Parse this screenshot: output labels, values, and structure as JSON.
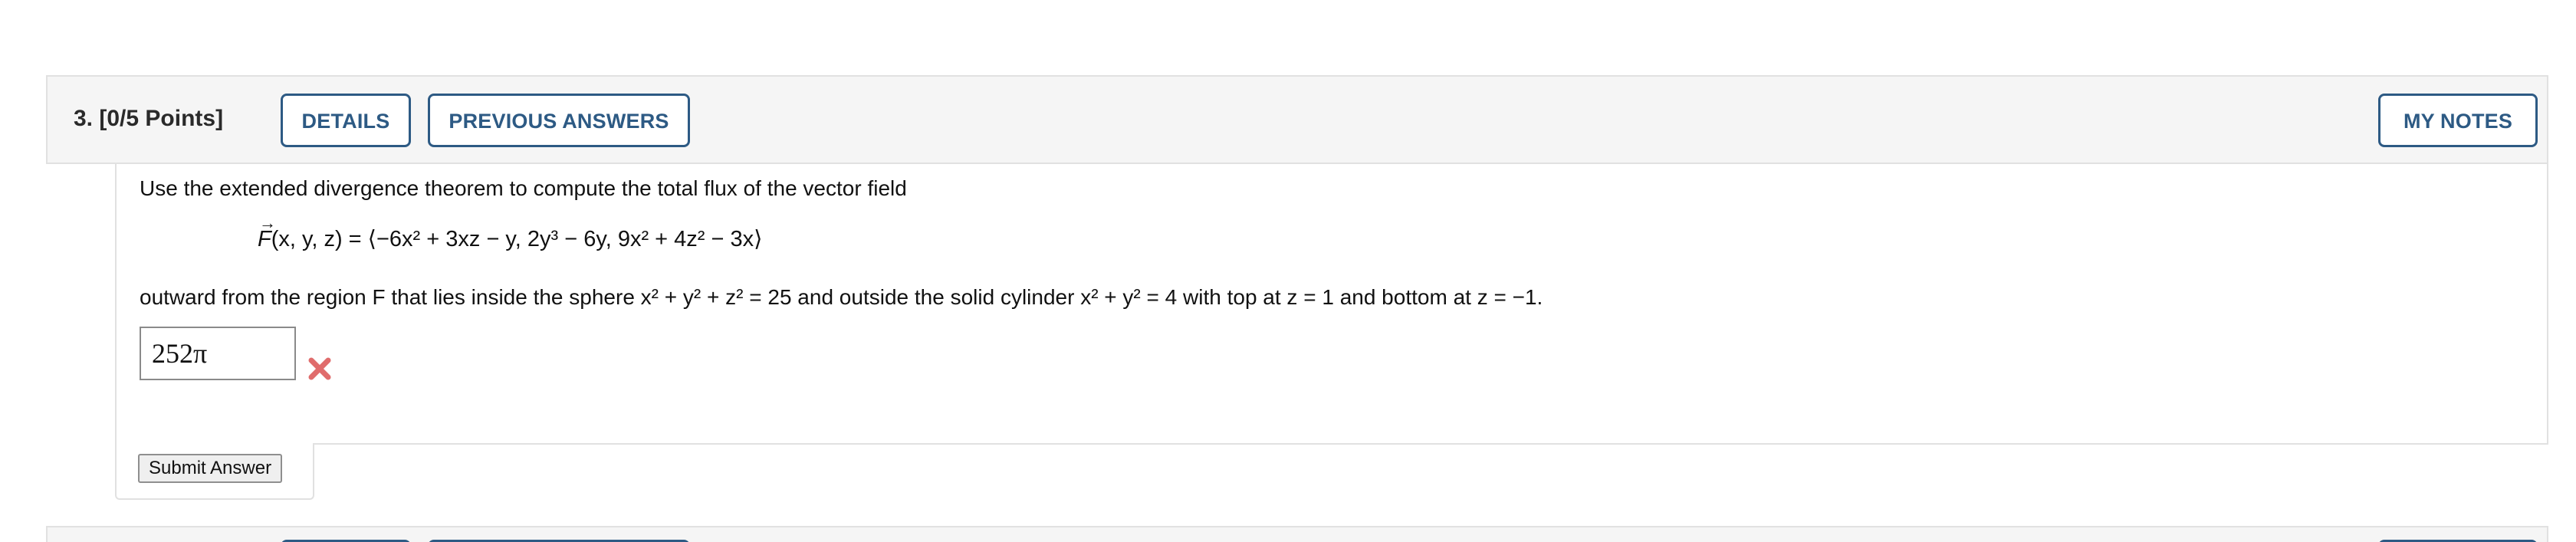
{
  "question": {
    "number_label": "3.",
    "points_label": "[0/5 Points]",
    "details_button": "DETAILS",
    "previous_answers_button": "PREVIOUS ANSWERS",
    "my_notes_button": "MY NOTES"
  },
  "problem": {
    "intro": "Use the extended divergence theorem to compute the total flux of the vector field",
    "field_symbol": "F",
    "field_args": "(x, y, z) = ",
    "field_body": "⟨−6x² + 3xz − y, 2y³ − 6y, 9x² + 4z² − 3x⟩",
    "region_text": "outward from the region F that lies inside the sphere x² + y² + z² = 25 and outside the solid cylinder x² + y² = 4 with top at z = 1 and bottom at z = −1."
  },
  "answer": {
    "value": "252π",
    "status": "incorrect",
    "status_color": "#e06c6c"
  },
  "submit_button": "Submit Answer",
  "icons": {
    "wrong": "x-mark-icon",
    "vector_arrow": "vector-arrow-icon"
  },
  "colors": {
    "button_border": "#2d5a84",
    "header_bg": "#f5f5f5"
  }
}
